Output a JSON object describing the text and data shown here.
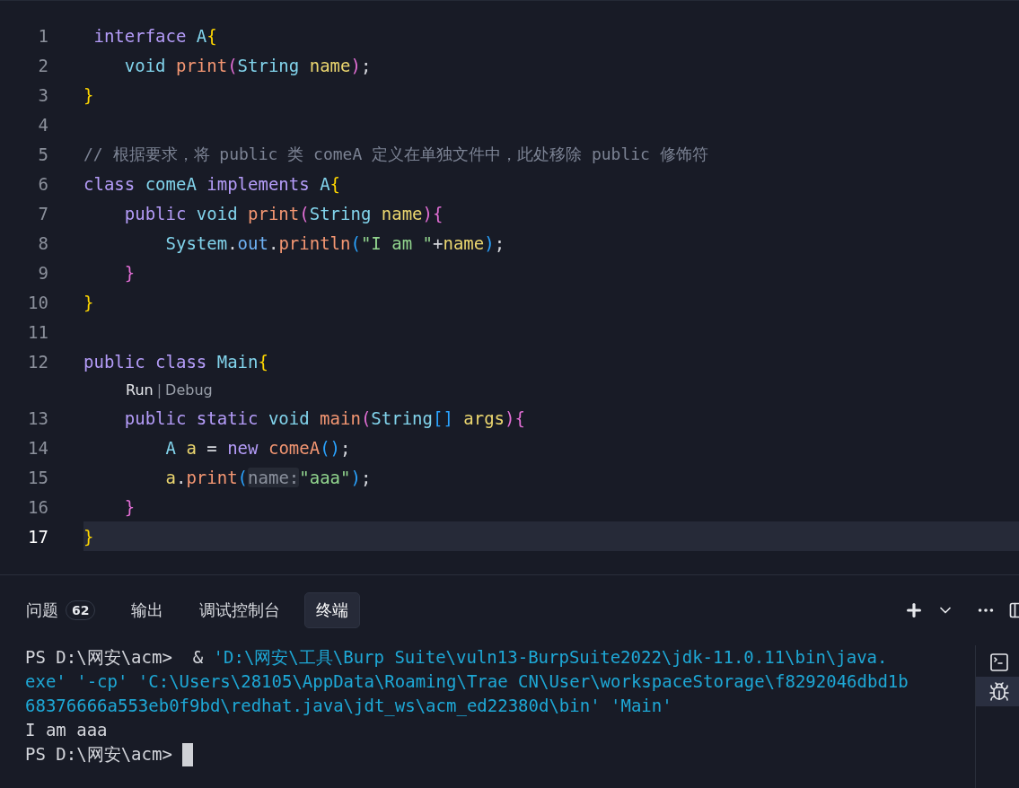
{
  "editor": {
    "lines": [
      {
        "kind": "code",
        "number": "1",
        "current": false,
        "tokens": [
          {
            "text": " interface",
            "kind": "kw"
          },
          {
            "text": " A",
            "kind": "type"
          },
          {
            "text": "{",
            "kind": "b1"
          }
        ]
      },
      {
        "kind": "code",
        "number": "2",
        "current": false,
        "tokens": [
          {
            "text": "    void",
            "kind": "type"
          },
          {
            "text": " print",
            "kind": "fn"
          },
          {
            "text": "(",
            "kind": "b2"
          },
          {
            "text": "String",
            "kind": "type"
          },
          {
            "text": " name",
            "kind": "var"
          },
          {
            "text": ")",
            "kind": "b2"
          },
          {
            "text": ";",
            "kind": "plain"
          }
        ]
      },
      {
        "kind": "code",
        "number": "3",
        "current": false,
        "tokens": [
          {
            "text": "}",
            "kind": "b1"
          }
        ]
      },
      {
        "kind": "code",
        "number": "4",
        "current": false
      },
      {
        "kind": "code",
        "number": "5",
        "current": false,
        "tokens": [
          {
            "text": "// 根据要求，将 public 类 comeA 定义在单独文件中，此处移除 public 修饰符",
            "kind": "comment"
          }
        ]
      },
      {
        "kind": "code",
        "number": "6",
        "current": false,
        "tokens": [
          {
            "text": "class",
            "kind": "kw"
          },
          {
            "text": " comeA",
            "kind": "type"
          },
          {
            "text": " implements",
            "kind": "kw"
          },
          {
            "text": " A",
            "kind": "type"
          },
          {
            "text": "{",
            "kind": "b1"
          }
        ]
      },
      {
        "kind": "code",
        "number": "7",
        "current": false,
        "tokens": [
          {
            "text": "    public",
            "kind": "kw"
          },
          {
            "text": " void",
            "kind": "type"
          },
          {
            "text": " print",
            "kind": "fn"
          },
          {
            "text": "(",
            "kind": "b2"
          },
          {
            "text": "String",
            "kind": "type"
          },
          {
            "text": " name",
            "kind": "var"
          },
          {
            "text": "){",
            "kind": "b2"
          }
        ]
      },
      {
        "kind": "code",
        "number": "8",
        "current": false,
        "tokens": [
          {
            "text": "        System",
            "kind": "type"
          },
          {
            "text": ".",
            "kind": "plain"
          },
          {
            "text": "out",
            "kind": "field"
          },
          {
            "text": ".",
            "kind": "plain"
          },
          {
            "text": "println",
            "kind": "fn"
          },
          {
            "text": "(",
            "kind": "b3"
          },
          {
            "text": "\"I am \"",
            "kind": "str"
          },
          {
            "text": "+",
            "kind": "plain"
          },
          {
            "text": "name",
            "kind": "var"
          },
          {
            "text": ")",
            "kind": "b3"
          },
          {
            "text": ";",
            "kind": "plain"
          }
        ]
      },
      {
        "kind": "code",
        "number": "9",
        "current": false,
        "tokens": [
          {
            "text": "    }",
            "kind": "b2"
          }
        ]
      },
      {
        "kind": "code",
        "number": "10",
        "current": false,
        "tokens": [
          {
            "text": "}",
            "kind": "b1"
          }
        ]
      },
      {
        "kind": "code",
        "number": "11",
        "current": false
      },
      {
        "kind": "code",
        "number": "12",
        "current": false,
        "tokens": [
          {
            "text": "public",
            "kind": "kw"
          },
          {
            "text": " class",
            "kind": "kw"
          },
          {
            "text": " Main",
            "kind": "type"
          },
          {
            "text": "{",
            "kind": "b1"
          }
        ]
      },
      {
        "kind": "codelens",
        "links": [
          "Run",
          "Debug"
        ],
        "separator": "|"
      },
      {
        "kind": "code",
        "number": "13",
        "current": false,
        "tokens": [
          {
            "text": "    public",
            "kind": "kw"
          },
          {
            "text": " static",
            "kind": "kw"
          },
          {
            "text": " void",
            "kind": "type"
          },
          {
            "text": " main",
            "kind": "fn"
          },
          {
            "text": "(",
            "kind": "b2"
          },
          {
            "text": "String",
            "kind": "type"
          },
          {
            "text": "[]",
            "kind": "b3"
          },
          {
            "text": " args",
            "kind": "var"
          },
          {
            "text": "){",
            "kind": "b2"
          }
        ]
      },
      {
        "kind": "code",
        "number": "14",
        "current": false,
        "tokens": [
          {
            "text": "        A",
            "kind": "type"
          },
          {
            "text": " a",
            "kind": "var"
          },
          {
            "text": " =",
            "kind": "plain"
          },
          {
            "text": " new",
            "kind": "kw"
          },
          {
            "text": " comeA",
            "kind": "fn"
          },
          {
            "text": "()",
            "kind": "b3"
          },
          {
            "text": ";",
            "kind": "plain"
          }
        ]
      },
      {
        "kind": "code",
        "number": "15",
        "current": false,
        "tokens": [
          {
            "text": "        a",
            "kind": "var"
          },
          {
            "text": ".",
            "kind": "plain"
          },
          {
            "text": "print",
            "kind": "fn"
          },
          {
            "text": "(",
            "kind": "b3"
          },
          {
            "text": "name:",
            "kind": "hint"
          },
          {
            "text": "\"aaa\"",
            "kind": "str"
          },
          {
            "text": ")",
            "kind": "b3"
          },
          {
            "text": ";",
            "kind": "plain"
          }
        ]
      },
      {
        "kind": "code",
        "number": "16",
        "current": false,
        "tokens": [
          {
            "text": "    }",
            "kind": "b2"
          }
        ]
      },
      {
        "kind": "code",
        "number": "17",
        "current": true,
        "tokens": [
          {
            "text": "}",
            "kind": "b1"
          }
        ]
      }
    ]
  },
  "panel": {
    "tabs": [
      {
        "label": "问题",
        "badge": "62",
        "selected": false
      },
      {
        "label": "输出",
        "selected": false
      },
      {
        "label": "调试控制台",
        "selected": false
      },
      {
        "label": "终端",
        "selected": true
      }
    ],
    "terminal": {
      "lines": [
        [
          {
            "text": "PS D:\\网安\\acm>  & ",
            "kind": "plain"
          },
          {
            "text": "'D:\\网安\\工具\\Burp Suite\\vuln13-BurpSuite2022\\jdk-11.0.11\\bin\\java.",
            "kind": "path"
          }
        ],
        [
          {
            "text": "exe' '-cp' 'C:\\Users\\28105\\AppData\\Roaming\\Trae CN\\User\\workspaceStorage\\f8292046dbd1b",
            "kind": "path"
          }
        ],
        [
          {
            "text": "68376666a553eb0f9bd\\redhat.java\\jdt_ws\\acm_ed22380d\\bin' 'Main'",
            "kind": "path"
          }
        ],
        [
          {
            "text": "I am aaa",
            "kind": "plain"
          }
        ],
        [
          {
            "text": "PS D:\\网安\\acm> ",
            "kind": "plain"
          }
        ]
      ],
      "cursor": true
    },
    "sessions": [
      {
        "kind": "shell",
        "selected": false
      },
      {
        "kind": "debug",
        "selected": true
      }
    ]
  }
}
